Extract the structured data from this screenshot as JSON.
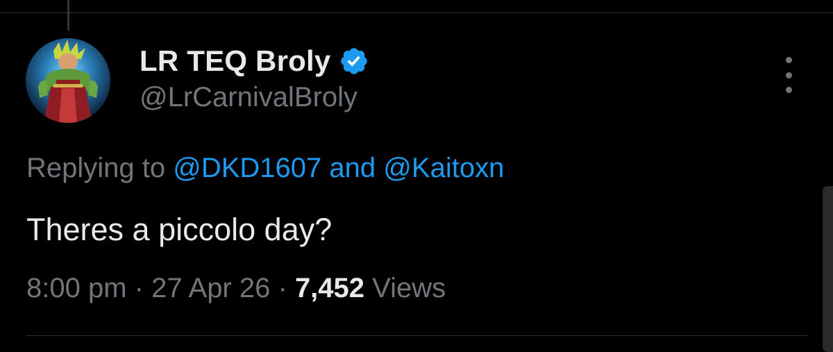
{
  "tweet": {
    "author": {
      "display_name": "LR TEQ Broly",
      "handle": "@LrCarnivalBroly",
      "verified": true,
      "avatar_icon": "broly-avatar"
    },
    "reply_context": {
      "prefix": "Replying to",
      "mention_1": "@DKD1607",
      "conjunction": "and",
      "mention_2": "@Kaitoxn"
    },
    "text": "Theres a piccolo day?",
    "time": "8:00 pm",
    "separator": "·",
    "date": "27 Apr 26",
    "views_count": "7,452",
    "views_label": "Views"
  },
  "colors": {
    "background": "#000000",
    "primary_text": "#e7e9ea",
    "secondary_text": "#71767b",
    "link": "#1d9bf0",
    "divider": "#2f3336"
  },
  "icons": {
    "verified": "verified-badge-icon",
    "more": "more-options-icon"
  }
}
